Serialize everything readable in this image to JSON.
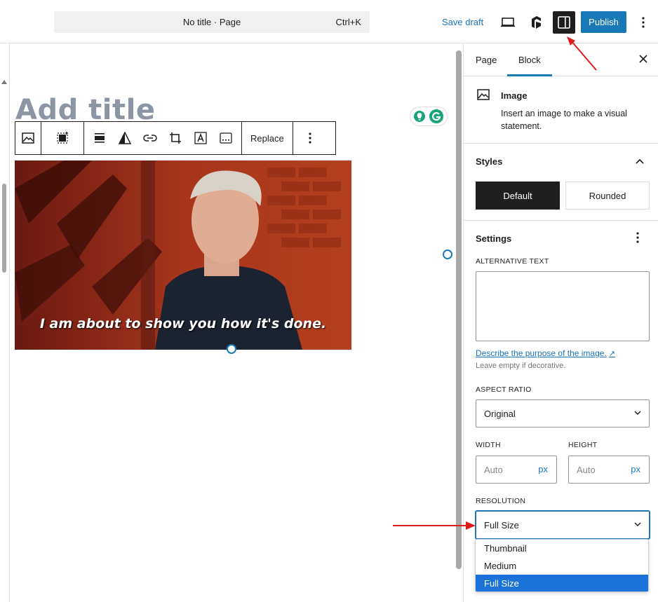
{
  "header": {
    "command_title": "No title · Page",
    "command_shortcut": "Ctrl+K",
    "save_draft": "Save draft",
    "publish": "Publish"
  },
  "editor": {
    "title_placeholder": "Add title",
    "toolbar": {
      "replace": "Replace"
    },
    "image_caption": "I am about to show you how it's done."
  },
  "sidebar": {
    "tabs": [
      "Page",
      "Block"
    ],
    "active_tab": "Block",
    "block": {
      "name": "Image",
      "description": "Insert an image to make a visual statement."
    },
    "styles": {
      "title": "Styles",
      "options": [
        "Default",
        "Rounded"
      ],
      "selected": "Default"
    },
    "settings": {
      "title": "Settings",
      "alt_text_label": "ALTERNATIVE TEXT",
      "alt_text_value": "",
      "describe_link": "Describe the purpose of the image.",
      "describe_link_icon": "↗",
      "help_text": "Leave empty if decorative.",
      "aspect_ratio_label": "ASPECT RATIO",
      "aspect_ratio_value": "Original",
      "width_label": "WIDTH",
      "height_label": "HEIGHT",
      "width_placeholder": "Auto",
      "height_placeholder": "Auto",
      "unit": "px",
      "resolution_label": "RESOLUTION",
      "resolution_value": "Full Size",
      "resolution_options": [
        "Thumbnail",
        "Medium",
        "Full Size"
      ]
    }
  },
  "colors": {
    "accent": "#1979b6",
    "annotation": "#e01b1b"
  }
}
